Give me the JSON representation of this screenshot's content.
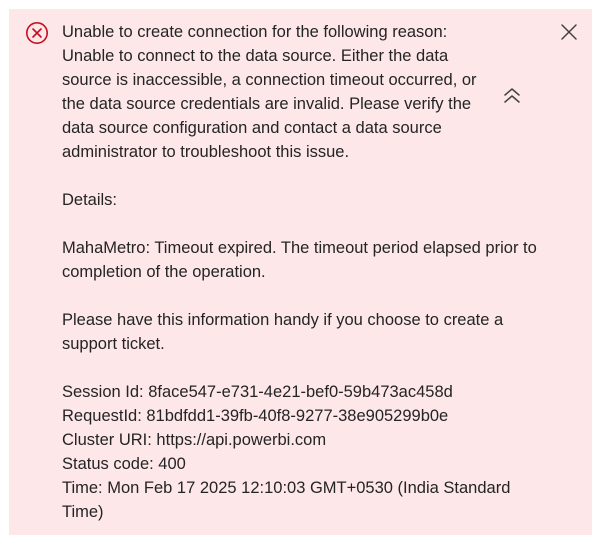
{
  "colors": {
    "background": "#fde7e9",
    "error_accent": "#c50f1f",
    "text": "#242424",
    "control": "#424242"
  },
  "icons": {
    "status": "error-circle-x-icon",
    "close": "close-icon",
    "collapse": "chevron-double-up-icon"
  },
  "message": {
    "summary": "Unable to create connection for the following reason: Unable to connect to the data source. Either the data source is inaccessible, a connection timeout occurred, or the data source credentials are invalid. Please verify the data source configuration and contact a data source administrator to troubleshoot this issue.",
    "details_label": "Details:",
    "details_text": "MahaMetro: Timeout expired. The timeout period elapsed prior to completion of the operation.",
    "support_note": "Please have this information handy if you choose to create a support ticket.",
    "session_id": "Session Id: 8face547-e731-4e21-bef0-59b473ac458d",
    "request_id": "RequestId: 81bdfdd1-39fb-40f8-9277-38e905299b0e",
    "cluster_uri": "Cluster URI: https://api.powerbi.com",
    "status_code": "Status code: 400",
    "time": "Time: Mon Feb 17 2025 12:10:03 GMT+0530 (India Standard Time)"
  }
}
